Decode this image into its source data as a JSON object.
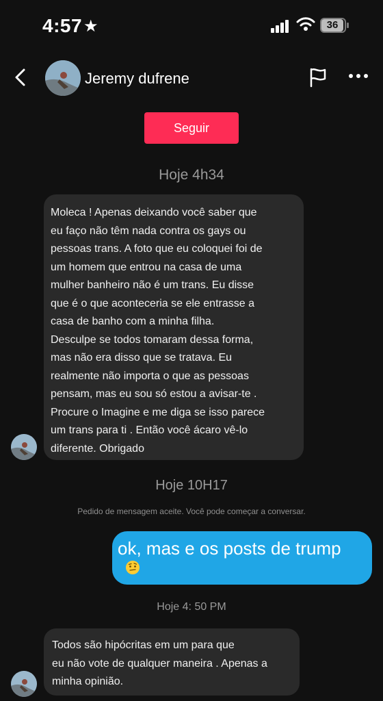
{
  "status_bar": {
    "time": "4:57",
    "star": "★",
    "battery": "36"
  },
  "header": {
    "contact_name": "Jeremy dufrene",
    "icons": [
      "chevron-left-icon",
      "avatar",
      "flag-icon",
      "more-icon"
    ]
  },
  "follow": {
    "label": "Seguir",
    "color": "#fe2c55"
  },
  "messages": [
    {
      "time": "Hoje 4h34",
      "text": "Moleca ! Apenas deixando você saber que\n eu faço não têm nada contra os gays ou\n pessoas trans. A foto que eu coloquei foi de\num homem que entrou na casa de uma\n mulher banheiro não é um trans. Eu disse\nque é o que aconteceria se ele entrasse a\n casa de banho com a minha filha.\n  Desculpe se todos tomaram dessa forma,\n mas não era disso que se tratava. Eu\n realmente não importa o que as pessoas\n pensam, mas eu sou só estou a avisar-te .\nProcure o Imagine e me diga se isso parece\num trans para ti . Então você ácaro vê-lo\n diferente. Obrigado"
    },
    {
      "time": "Hoje 10H17",
      "system_note": "Pedido de mensagem aceite. Você pode começar a conversar."
    },
    {
      "text": "ok, mas e os posts de trump",
      "emoji": "🤨"
    },
    {
      "time": "Hoje 4: 50 PM",
      "text": "Todos são hipócritas em um para que\neu não vote de qualquer maneira . Apenas a\nminha opinião."
    }
  ],
  "colors": {
    "background": "#111111",
    "incoming_bubble": "#2a2a2a",
    "outgoing_bubble": "#20a6e6",
    "timestamp": "#9a9a9a"
  }
}
